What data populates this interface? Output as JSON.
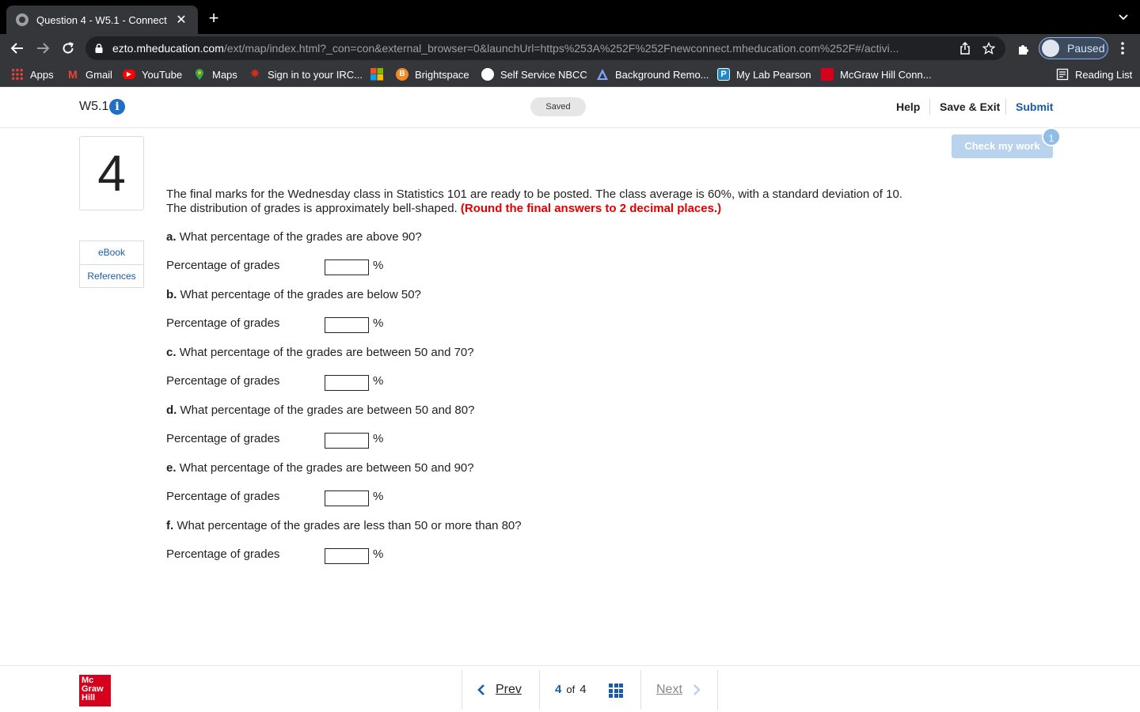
{
  "browser": {
    "tab_title": "Question 4 - W5.1 - Connect",
    "new_tab_label": "+",
    "url_host": "ezto.mheducation.com",
    "url_path": "/ext/map/index.html?_con=con&external_browser=0&launchUrl=https%253A%252F%252Fnewconnect.mheducation.com%252F#/activi...",
    "profile_label": "Paused",
    "bookmarks": [
      {
        "label": "Apps",
        "icon": "apps-grid-icon",
        "color": "#4285f4"
      },
      {
        "label": "Gmail",
        "icon": "gmail-icon",
        "color": "#ea4335"
      },
      {
        "label": "YouTube",
        "icon": "youtube-icon",
        "color": "#ff0000"
      },
      {
        "label": "Maps",
        "icon": "maps-pin-icon",
        "color": "#34a853"
      },
      {
        "label": "Sign in to your IRC...",
        "icon": "maple-leaf-icon",
        "color": "#d52b1e"
      },
      {
        "label": "",
        "icon": "microsoft-icon",
        "color": "#f25022"
      },
      {
        "label": "Brightspace",
        "icon": "brightspace-icon",
        "color": "#f08a24"
      },
      {
        "label": "Self Service NBCC",
        "icon": "nbcc-icon",
        "color": "#ffffff"
      },
      {
        "label": "Background Remo...",
        "icon": "background-remover-icon",
        "color": "#7aa7ff"
      },
      {
        "label": "My Lab Pearson",
        "icon": "pearson-icon",
        "color": "#1a88c9"
      },
      {
        "label": "McGraw Hill Conn...",
        "icon": "mcgraw-hill-icon",
        "color": "#d5001c"
      }
    ],
    "reading_list_label": "Reading List"
  },
  "header": {
    "assignment_title": "W5.1",
    "info_glyph": "i",
    "saved_label": "Saved",
    "help_label": "Help",
    "save_exit_label": "Save & Exit",
    "submit_label": "Submit"
  },
  "sidebar": {
    "question_number": "4",
    "links": [
      {
        "label": "eBook"
      },
      {
        "label": "References"
      }
    ]
  },
  "check_work": {
    "label": "Check my work",
    "badge": "1"
  },
  "question": {
    "text": "The final marks for the Wednesday class in Statistics 101 are ready to be posted. The class average is 60%, with a standard deviation of 10. The distribution of grades is approximately bell-shaped.",
    "note": "(Round the final answers to 2 decimal places.)",
    "parts": [
      {
        "letter": "a.",
        "prompt": "What percentage of the grades are above 90?",
        "answer_label": "Percentage of grades",
        "value": "",
        "unit": "%"
      },
      {
        "letter": "b.",
        "prompt": "What percentage of the grades are below 50?",
        "answer_label": "Percentage of grades",
        "value": "",
        "unit": "%"
      },
      {
        "letter": "c.",
        "prompt": "What percentage of the grades are between 50 and 70?",
        "answer_label": "Percentage of grades",
        "value": "",
        "unit": "%"
      },
      {
        "letter": "d.",
        "prompt": "What percentage of the grades are between 50 and 80?",
        "answer_label": "Percentage of grades",
        "value": "",
        "unit": "%"
      },
      {
        "letter": "e.",
        "prompt": "What percentage of the grades are between 50 and 90?",
        "answer_label": "Percentage of grades",
        "value": "",
        "unit": "%"
      },
      {
        "letter": "f.",
        "prompt": "What percentage of the grades are less than 50 or more than 80?",
        "answer_label": "Percentage of grades",
        "value": "",
        "unit": "%"
      }
    ]
  },
  "footer": {
    "logo_lines": [
      "Mc",
      "Graw",
      "Hill"
    ],
    "prev_label": "Prev",
    "current_page": "4",
    "of_label": "of",
    "total_pages": "4",
    "next_label": "Next"
  },
  "colors": {
    "brand_blue": "#1a5ba6",
    "note_red": "#e00000",
    "logo_red": "#d5001c"
  }
}
